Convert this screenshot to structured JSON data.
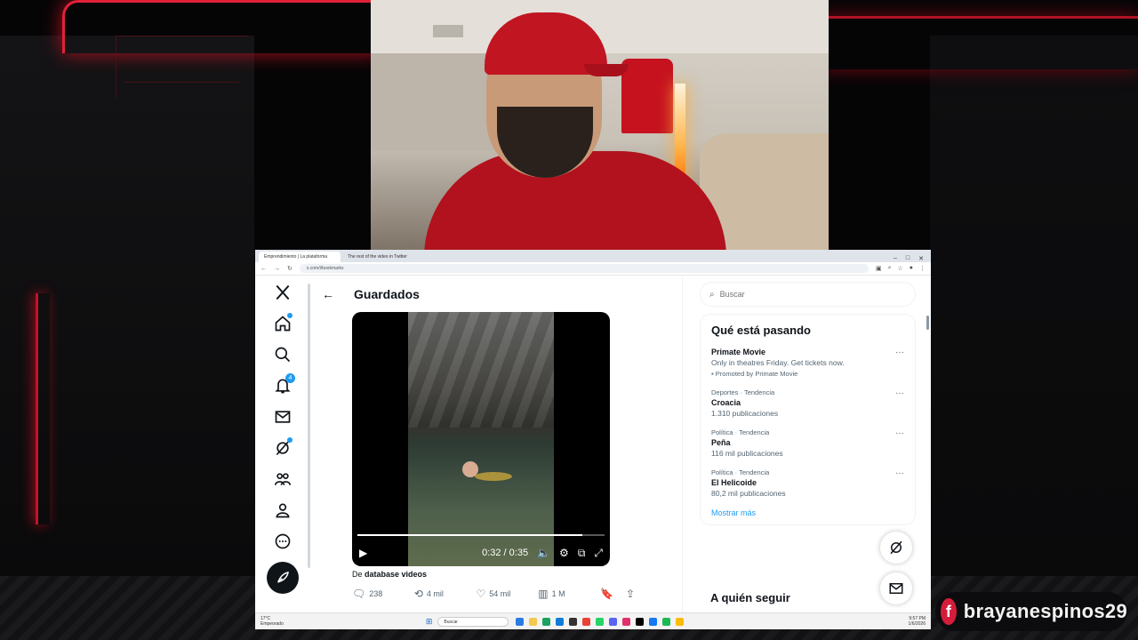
{
  "stream": {
    "handle": "brayanespinos29"
  },
  "browser": {
    "tabs": [
      {
        "label": "Emprendimiento | La plataforma"
      },
      {
        "label": "The rest of the video in Twitter"
      }
    ],
    "url": "x.com/i/bookmarks",
    "window_controls": [
      "–",
      "□",
      "✕"
    ]
  },
  "x": {
    "header": {
      "back_label": "←",
      "title": "Guardados"
    },
    "nav": {
      "notifications_count": "4"
    },
    "post": {
      "video": {
        "time": "0:32 / 0:35",
        "progress": 0.91
      },
      "source_prefix": "De",
      "source_name": "database videos",
      "replies": "238",
      "reposts": "4 mil",
      "likes": "54 mil",
      "views": "1 M"
    },
    "search": {
      "placeholder": "Buscar"
    },
    "trends": {
      "title": "Qué está pasando",
      "items": [
        {
          "meta": "",
          "name": "Primate Movie",
          "desc": "Only in theatres Friday. Get tickets now.",
          "promoted": "Promoted by Primate Movie"
        },
        {
          "meta": "Deportes · Tendencia",
          "name": "Croacia",
          "desc": "1.310 publicaciones"
        },
        {
          "meta": "Política · Tendencia",
          "name": "Peña",
          "desc": "116 mil publicaciones"
        },
        {
          "meta": "Política · Tendencia",
          "name": "El Helicoide",
          "desc": "80,2 mil publicaciones"
        }
      ],
      "more_glyph": "···",
      "show_more": "Mostrar más"
    },
    "who_to_follow": {
      "title": "A quién seguir"
    }
  },
  "taskbar": {
    "weather_temp": "17°C",
    "weather_desc": "Empeorado",
    "search": "Buscar",
    "time": "9:57 PM",
    "date": "1/6/2026"
  },
  "colors": {
    "accent": "#1d9bf0",
    "stream_red": "#d41d3a"
  }
}
